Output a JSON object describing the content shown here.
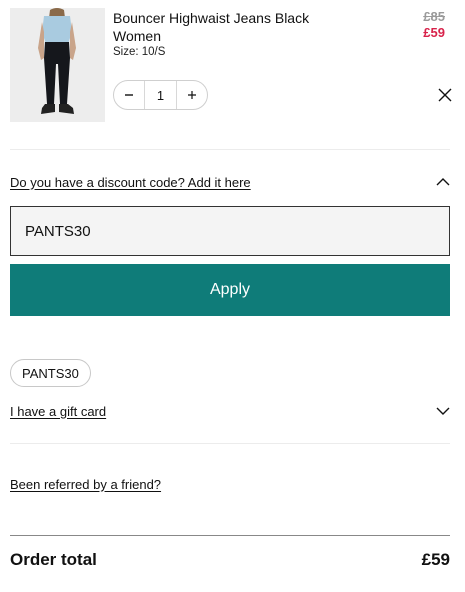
{
  "cart_item": {
    "name": "Bouncer Highwaist Jeans Black Women",
    "size": "Size: 10/S",
    "price_old": "£85",
    "price_new": "£59",
    "quantity": "1",
    "image_icon": "product-photo-black-jeans"
  },
  "discount": {
    "link_label": "Do you have a discount code? Add it here",
    "input_value": "PANTS30",
    "apply_label": "Apply",
    "applied_code": "PANTS30"
  },
  "gift_card": {
    "link_label": "I have a gift card"
  },
  "referral": {
    "link_label": "Been referred by a friend?"
  },
  "order_total": {
    "label": "Order total",
    "value": "£59"
  },
  "colors": {
    "accent": "#0f7c79",
    "sale_price": "#d8224a"
  }
}
